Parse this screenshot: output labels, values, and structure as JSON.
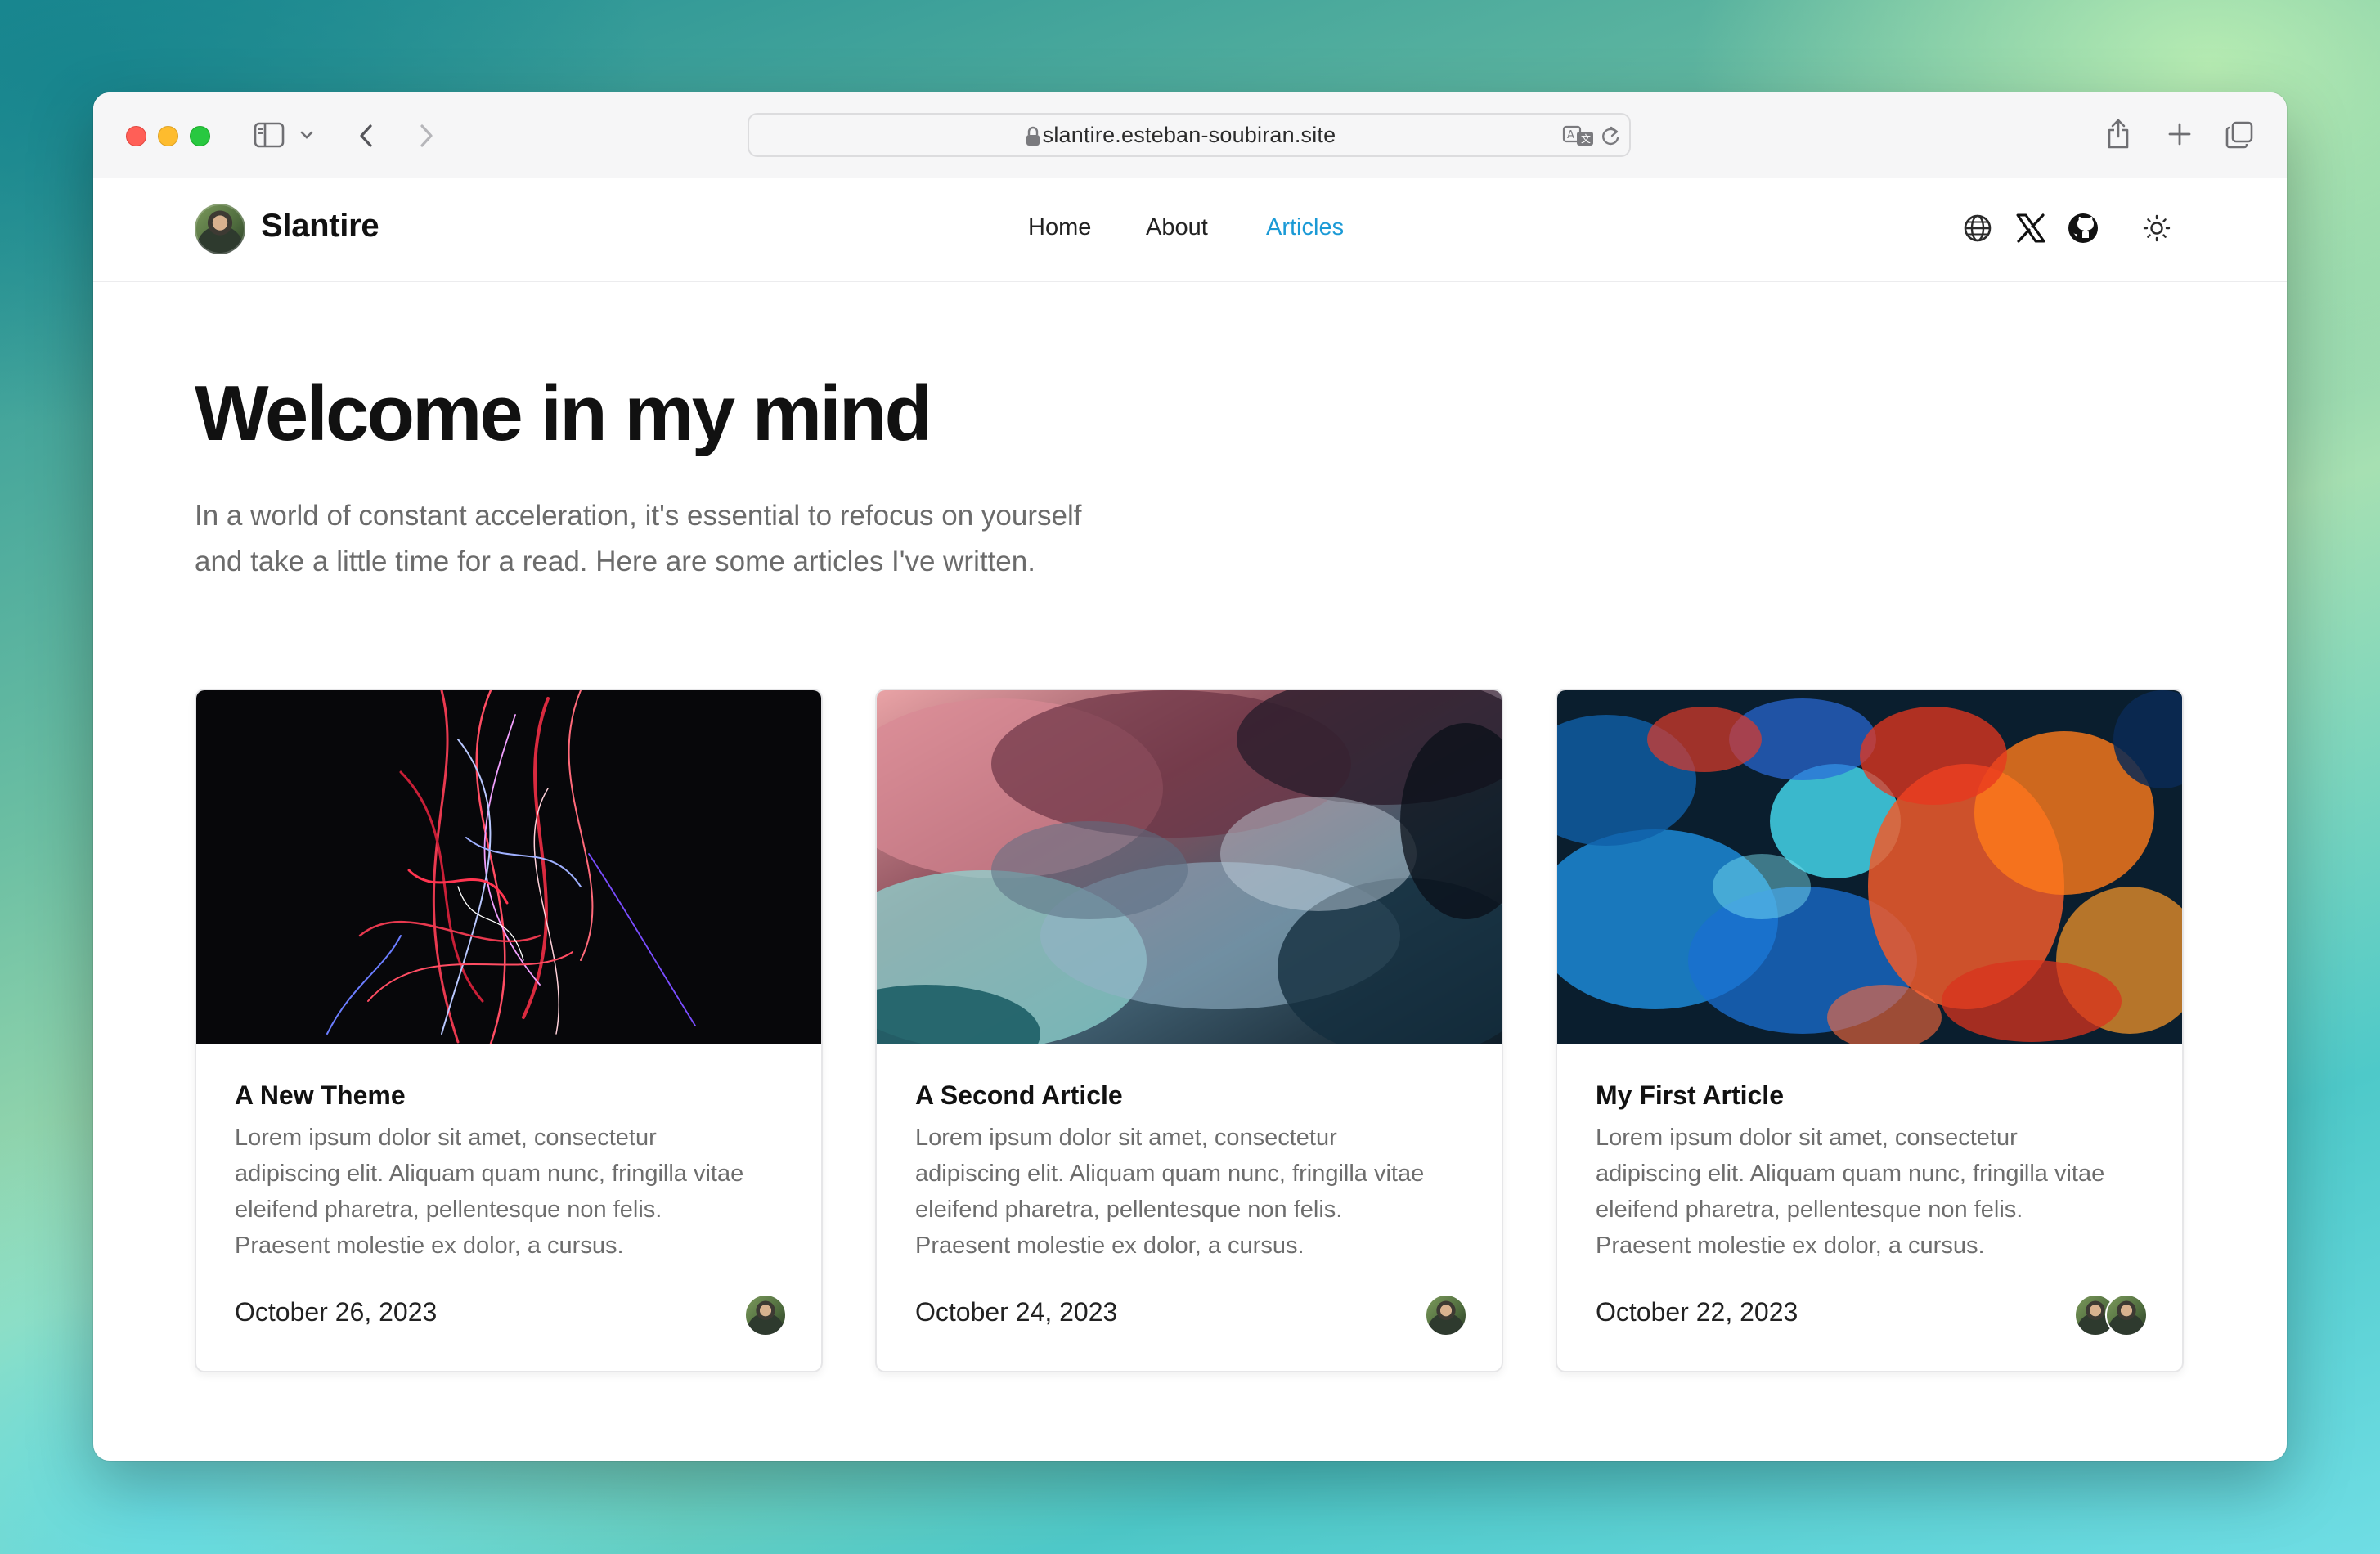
{
  "browser": {
    "url": "slantire.esteban-soubiran.site"
  },
  "site": {
    "brand": "Slantire",
    "nav": [
      {
        "label": "Home"
      },
      {
        "label": "About"
      },
      {
        "label": "Articles"
      }
    ],
    "header_icons": [
      "globe-icon",
      "x-logo-icon",
      "github-icon",
      "sun-icon"
    ]
  },
  "hero": {
    "title": "Welcome in my mind",
    "description_line1": "In a world of constant acceleration, it's essential to refocus on yourself",
    "description_line2": "and take a little time for a read. Here are some articles I've written."
  },
  "articles": [
    {
      "title": "A New Theme",
      "excerpt_lines": [
        "Lorem ipsum dolor sit amet, consectetur",
        "adipiscing elit. Aliquam quam nunc, fringilla vitae",
        "eleifend pharetra, pellentesque non felis.",
        "Praesent molestie ex dolor, a cursus."
      ],
      "date": "October 26, 2023"
    },
    {
      "title": "A Second Article",
      "excerpt_lines": [
        "Lorem ipsum dolor sit amet, consectetur",
        "adipiscing elit. Aliquam quam nunc, fringilla vitae",
        "eleifend pharetra, pellentesque non felis.",
        "Praesent molestie ex dolor, a cursus."
      ],
      "date": "October 24, 2023"
    },
    {
      "title": "My First Article",
      "excerpt_lines": [
        "Lorem ipsum dolor sit amet, consectetur",
        "adipiscing elit. Aliquam quam nunc, fringilla vitae",
        "eleifend pharetra, pellentesque non felis.",
        "Praesent molestie ex dolor, a cursus."
      ],
      "date": "October 22, 2023"
    }
  ],
  "colors": {
    "accent": "#1b9ad6",
    "title": "#111111",
    "muted": "#6b6b6b"
  }
}
